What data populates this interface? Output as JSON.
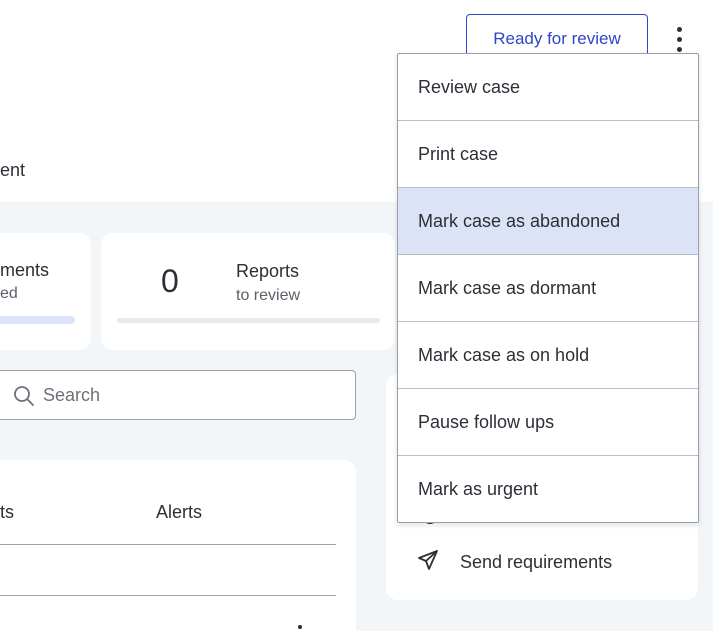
{
  "header": {
    "ready_for_review_label": "Ready for review",
    "more_actions_icon": "kebab-vertical-icon",
    "tab_fragment": "ent"
  },
  "stats": [
    {
      "label_fragment": "ments",
      "sub_fragment": "ed"
    },
    {
      "value": "0",
      "label": "Reports",
      "sub": "to review"
    }
  ],
  "search": {
    "placeholder": "Search",
    "value": "",
    "icon": "search-icon"
  },
  "table": {
    "columns": [
      "ts",
      "Alerts"
    ]
  },
  "right_panel": {
    "send_requirements_label": "Send requirements",
    "send_icon": "paper-plane-icon"
  },
  "menu": {
    "items": [
      "Review case",
      "Print case",
      "Mark case as abandoned",
      "Mark case as dormant",
      "Mark case as on hold",
      "Pause follow ups",
      "Mark as urgent"
    ],
    "highlighted_index": 2
  },
  "colors": {
    "accent": "#2f45c8",
    "menu_highlight": "#dde3f6",
    "content_background": "#f3f6f9"
  }
}
